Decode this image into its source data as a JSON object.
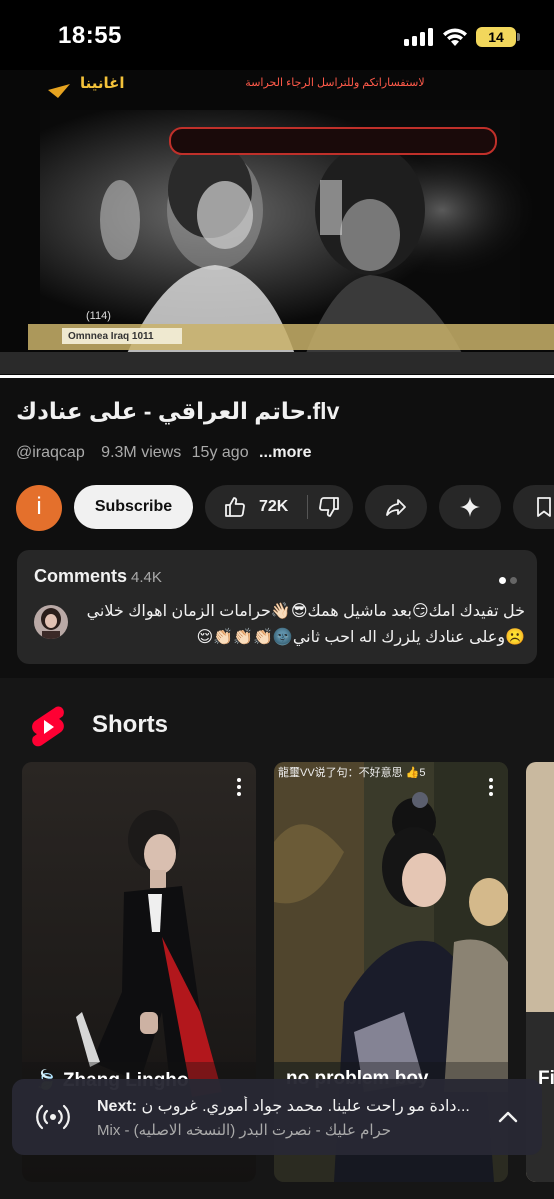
{
  "status_bar": {
    "time": "18:55",
    "battery": "14"
  },
  "video": {
    "overlay_logo": "اغانينا",
    "overlay_banner": "لاستفساراتكم وللتراسل الرجاء الحراسة",
    "overlay_ticker": "Omnnea Iraq 1011",
    "overlay_count": "(114)",
    "progress": 1.0
  },
  "title": "حاتم العراقي - على عنادك.flv",
  "meta": {
    "handle": "@iraqcap",
    "views": "9.3M views",
    "age": "15y ago",
    "more": "...more"
  },
  "channel": {
    "avatar_letter": "i"
  },
  "actions": {
    "subscribe": "Subscribe",
    "likes": "72K"
  },
  "comments": {
    "label": "Comments",
    "count": "4.4K",
    "top_comment": "خل تفيدك امك😏بعد ماشيل همك😎👋🏻حرامات الزمان اهواك خلاني☹️وعلى عنادك يلزرك اله احب ثاني🌚👏🏻👏🏻👏🏻😌"
  },
  "shorts": {
    "title": "Shorts",
    "items": [
      {
        "caption": "🍃 Zhang Lingho"
      },
      {
        "caption": "no problem boy",
        "watermark": "龍璽VV说了句：不好意思 👍5"
      },
      {
        "caption": "Fi"
      }
    ]
  },
  "next": {
    "label": "Next:",
    "track": "دادة مو راحت علينا. محمد جواد أموري. غروب ن...",
    "mix": "Mix - (النسخه الاصليه) حرام عليك - نصرت البدر"
  },
  "colors": {
    "accent": "#ff0000",
    "avatar": "#e4702c",
    "battery": "#f2d75c"
  }
}
